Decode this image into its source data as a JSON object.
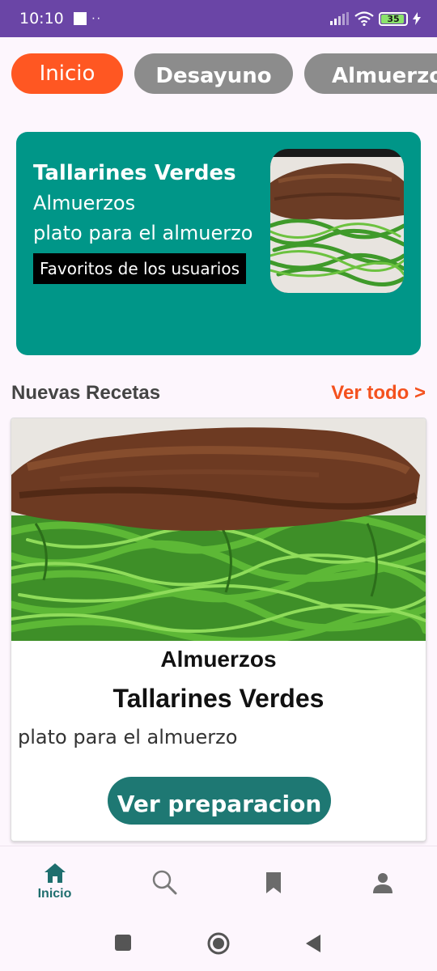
{
  "status_bar": {
    "time": "10:10",
    "dots": "··",
    "battery": "35"
  },
  "chips": [
    {
      "label": "Inicio",
      "active": true
    },
    {
      "label": "Desayuno",
      "active": false
    },
    {
      "label": "Almuerzos",
      "active": false
    }
  ],
  "featured": {
    "title": "Tallarines Verdes",
    "category": "Almuerzos",
    "description": "plato para el almuerzo",
    "badge": "Favoritos de los usuarios",
    "image_icon": "pasta-steak-photo"
  },
  "section": {
    "title": "Nuevas Recetas",
    "see_all": "Ver todo >"
  },
  "recipe_card": {
    "category": "Almuerzos",
    "title": "Tallarines Verdes",
    "description": "plato para el almuerzo",
    "button": "Ver preparacion",
    "image_icon": "pasta-steak-photo"
  },
  "bottom_nav": [
    {
      "label": "Inicio",
      "icon": "home-icon",
      "active": true
    },
    {
      "label": "",
      "icon": "search-icon",
      "active": false
    },
    {
      "label": "",
      "icon": "bookmark-icon",
      "active": false
    },
    {
      "label": "",
      "icon": "person-icon",
      "active": false
    }
  ],
  "colors": {
    "status_bar": "#6a45a6",
    "accent_orange": "#ff5722",
    "chip_inactive": "#8c8c8c",
    "featured_bg": "#009688",
    "button_teal": "#1e7873",
    "background": "#fdf6fd"
  }
}
